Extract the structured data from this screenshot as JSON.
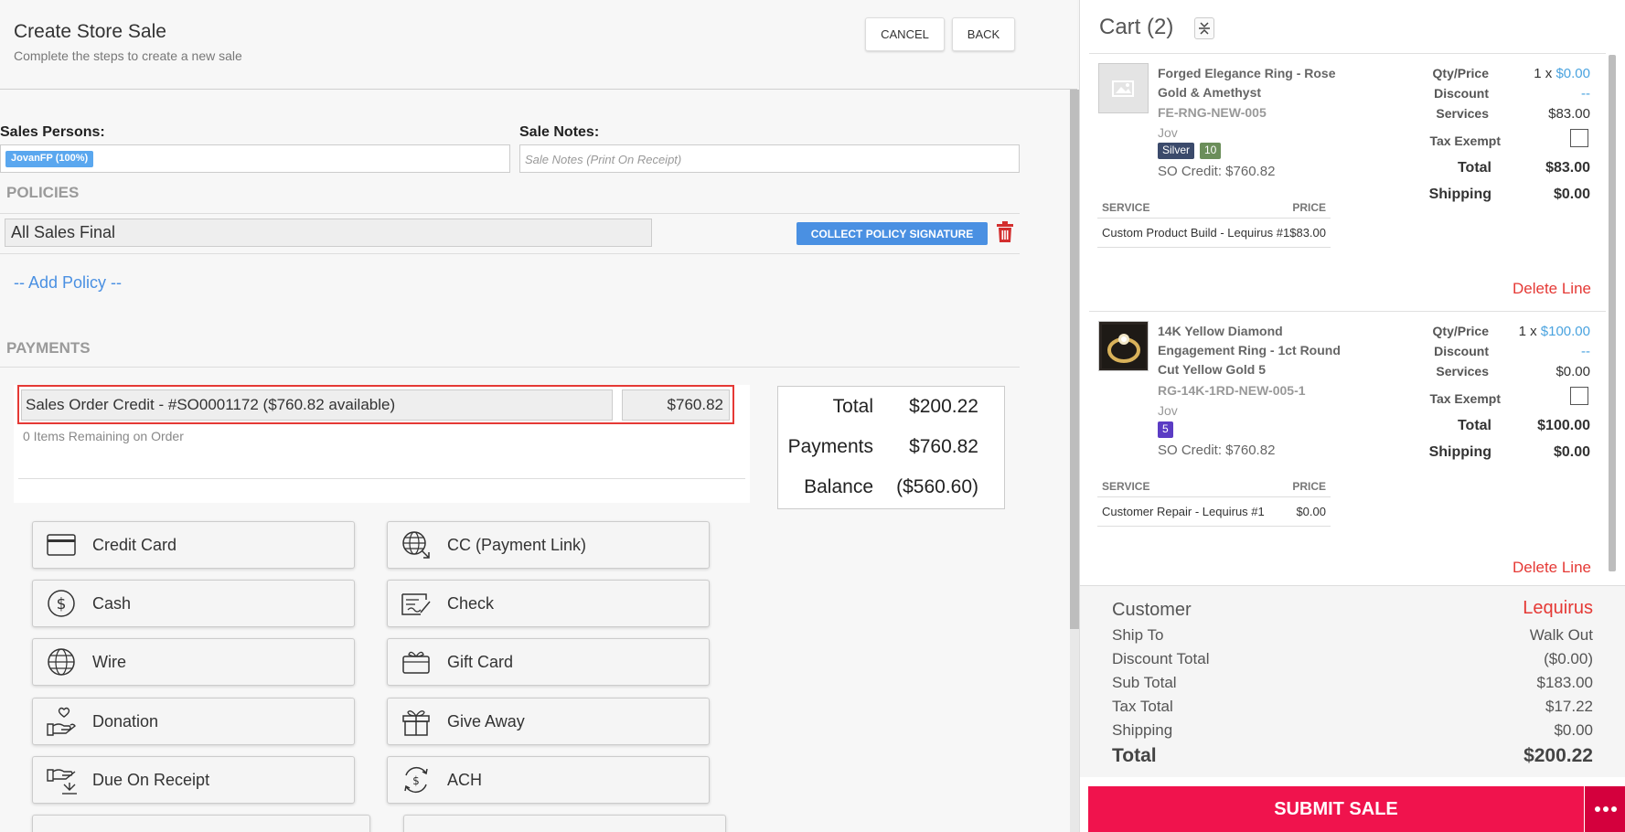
{
  "header": {
    "title": "Create Store Sale",
    "subtitle": "Complete the steps to create a new sale",
    "cancel_label": "CANCEL",
    "back_label": "BACK"
  },
  "sales_persons": {
    "label": "Sales Persons:",
    "chip": "JovanFP (100%)"
  },
  "sale_notes": {
    "label": "Sale Notes:",
    "placeholder": "Sale Notes (Print On Receipt)"
  },
  "policies": {
    "heading": "POLICIES",
    "items": [
      {
        "name": "All Sales Final"
      }
    ],
    "collect_label": "COLLECT POLICY SIGNATURE",
    "add_label": "-- Add Policy --"
  },
  "payments": {
    "heading": "PAYMENTS",
    "entries": [
      {
        "label": "Sales Order Credit - #SO0001172 ($760.82 available)",
        "amount": "$760.82"
      }
    ],
    "items_remaining": "0 Items Remaining on Order",
    "totals": {
      "total_label": "Total",
      "total_value": "$200.22",
      "payments_label": "Payments",
      "payments_value": "$760.82",
      "balance_label": "Balance",
      "balance_value": "($560.60)"
    },
    "methods": [
      {
        "label": "Credit Card",
        "icon": "credit-card-icon"
      },
      {
        "label": "CC (Payment Link)",
        "icon": "globe-link-icon"
      },
      {
        "label": "Cash",
        "icon": "dollar-coin-icon"
      },
      {
        "label": "Check",
        "icon": "check-icon"
      },
      {
        "label": "Wire",
        "icon": "globe-icon"
      },
      {
        "label": "Gift Card",
        "icon": "gift-card-icon"
      },
      {
        "label": "Donation",
        "icon": "donation-icon"
      },
      {
        "label": "Give Away",
        "icon": "gift-box-icon"
      },
      {
        "label": "Due On Receipt",
        "icon": "due-receipt-icon"
      },
      {
        "label": "ACH",
        "icon": "ach-icon"
      }
    ]
  },
  "cart": {
    "title": "Cart (2)",
    "items": [
      {
        "name": "Forged Elegance Ring - Rose Gold & Amethyst",
        "sku": "FE-RNG-NEW-005",
        "vendor": "Jov",
        "badges": [
          "Silver",
          "10"
        ],
        "so_credit": "SO Credit: $760.82",
        "qty_price_label": "Qty/Price",
        "qty": "1 x",
        "price": "$0.00",
        "discount_label": "Discount",
        "discount": "--",
        "services_label": "Services",
        "services": "$83.00",
        "tax_exempt_label": "Tax Exempt",
        "total_label": "Total",
        "total": "$83.00",
        "shipping_label": "Shipping",
        "shipping": "$0.00",
        "service_header": "SERVICE",
        "price_header": "PRICE",
        "services_list": [
          {
            "name": "Custom Product Build - Lequirus #1",
            "price": "$83.00"
          }
        ],
        "delete_label": "Delete Line"
      },
      {
        "name": "14K Yellow Diamond Engagement Ring - 1ct Round Cut Yellow Gold 5",
        "sku": "RG-14K-1RD-NEW-005-1",
        "vendor": "Jov",
        "badges": [
          "5"
        ],
        "so_credit": "SO Credit: $760.82",
        "qty_price_label": "Qty/Price",
        "qty": "1 x",
        "price": "$100.00",
        "discount_label": "Discount",
        "discount": "--",
        "services_label": "Services",
        "services": "$0.00",
        "tax_exempt_label": "Tax Exempt",
        "total_label": "Total",
        "total": "$100.00",
        "shipping_label": "Shipping",
        "shipping": "$0.00",
        "service_header": "SERVICE",
        "price_header": "PRICE",
        "services_list": [
          {
            "name": "Customer Repair - Lequirus #1",
            "price": "$0.00"
          }
        ],
        "delete_label": "Delete Line"
      }
    ],
    "summary": {
      "customer_label": "Customer",
      "customer": "Lequirus",
      "ship_to_label": "Ship To",
      "ship_to": "Walk Out",
      "discount_total_label": "Discount Total",
      "discount_total": "($0.00)",
      "sub_total_label": "Sub Total",
      "sub_total": "$183.00",
      "tax_total_label": "Tax Total",
      "tax_total": "$17.22",
      "shipping_label": "Shipping",
      "shipping": "$0.00",
      "total_label": "Total",
      "total": "$200.22"
    },
    "submit_label": "SUBMIT SALE"
  },
  "colors": {
    "accent_blue": "#4a90e2",
    "submit_red": "#f0134d",
    "delete_red": "#e53935",
    "badge_silver": "#3b4a6b",
    "badge_10": "#6b8e5a",
    "badge_5": "#5b3cc4"
  }
}
